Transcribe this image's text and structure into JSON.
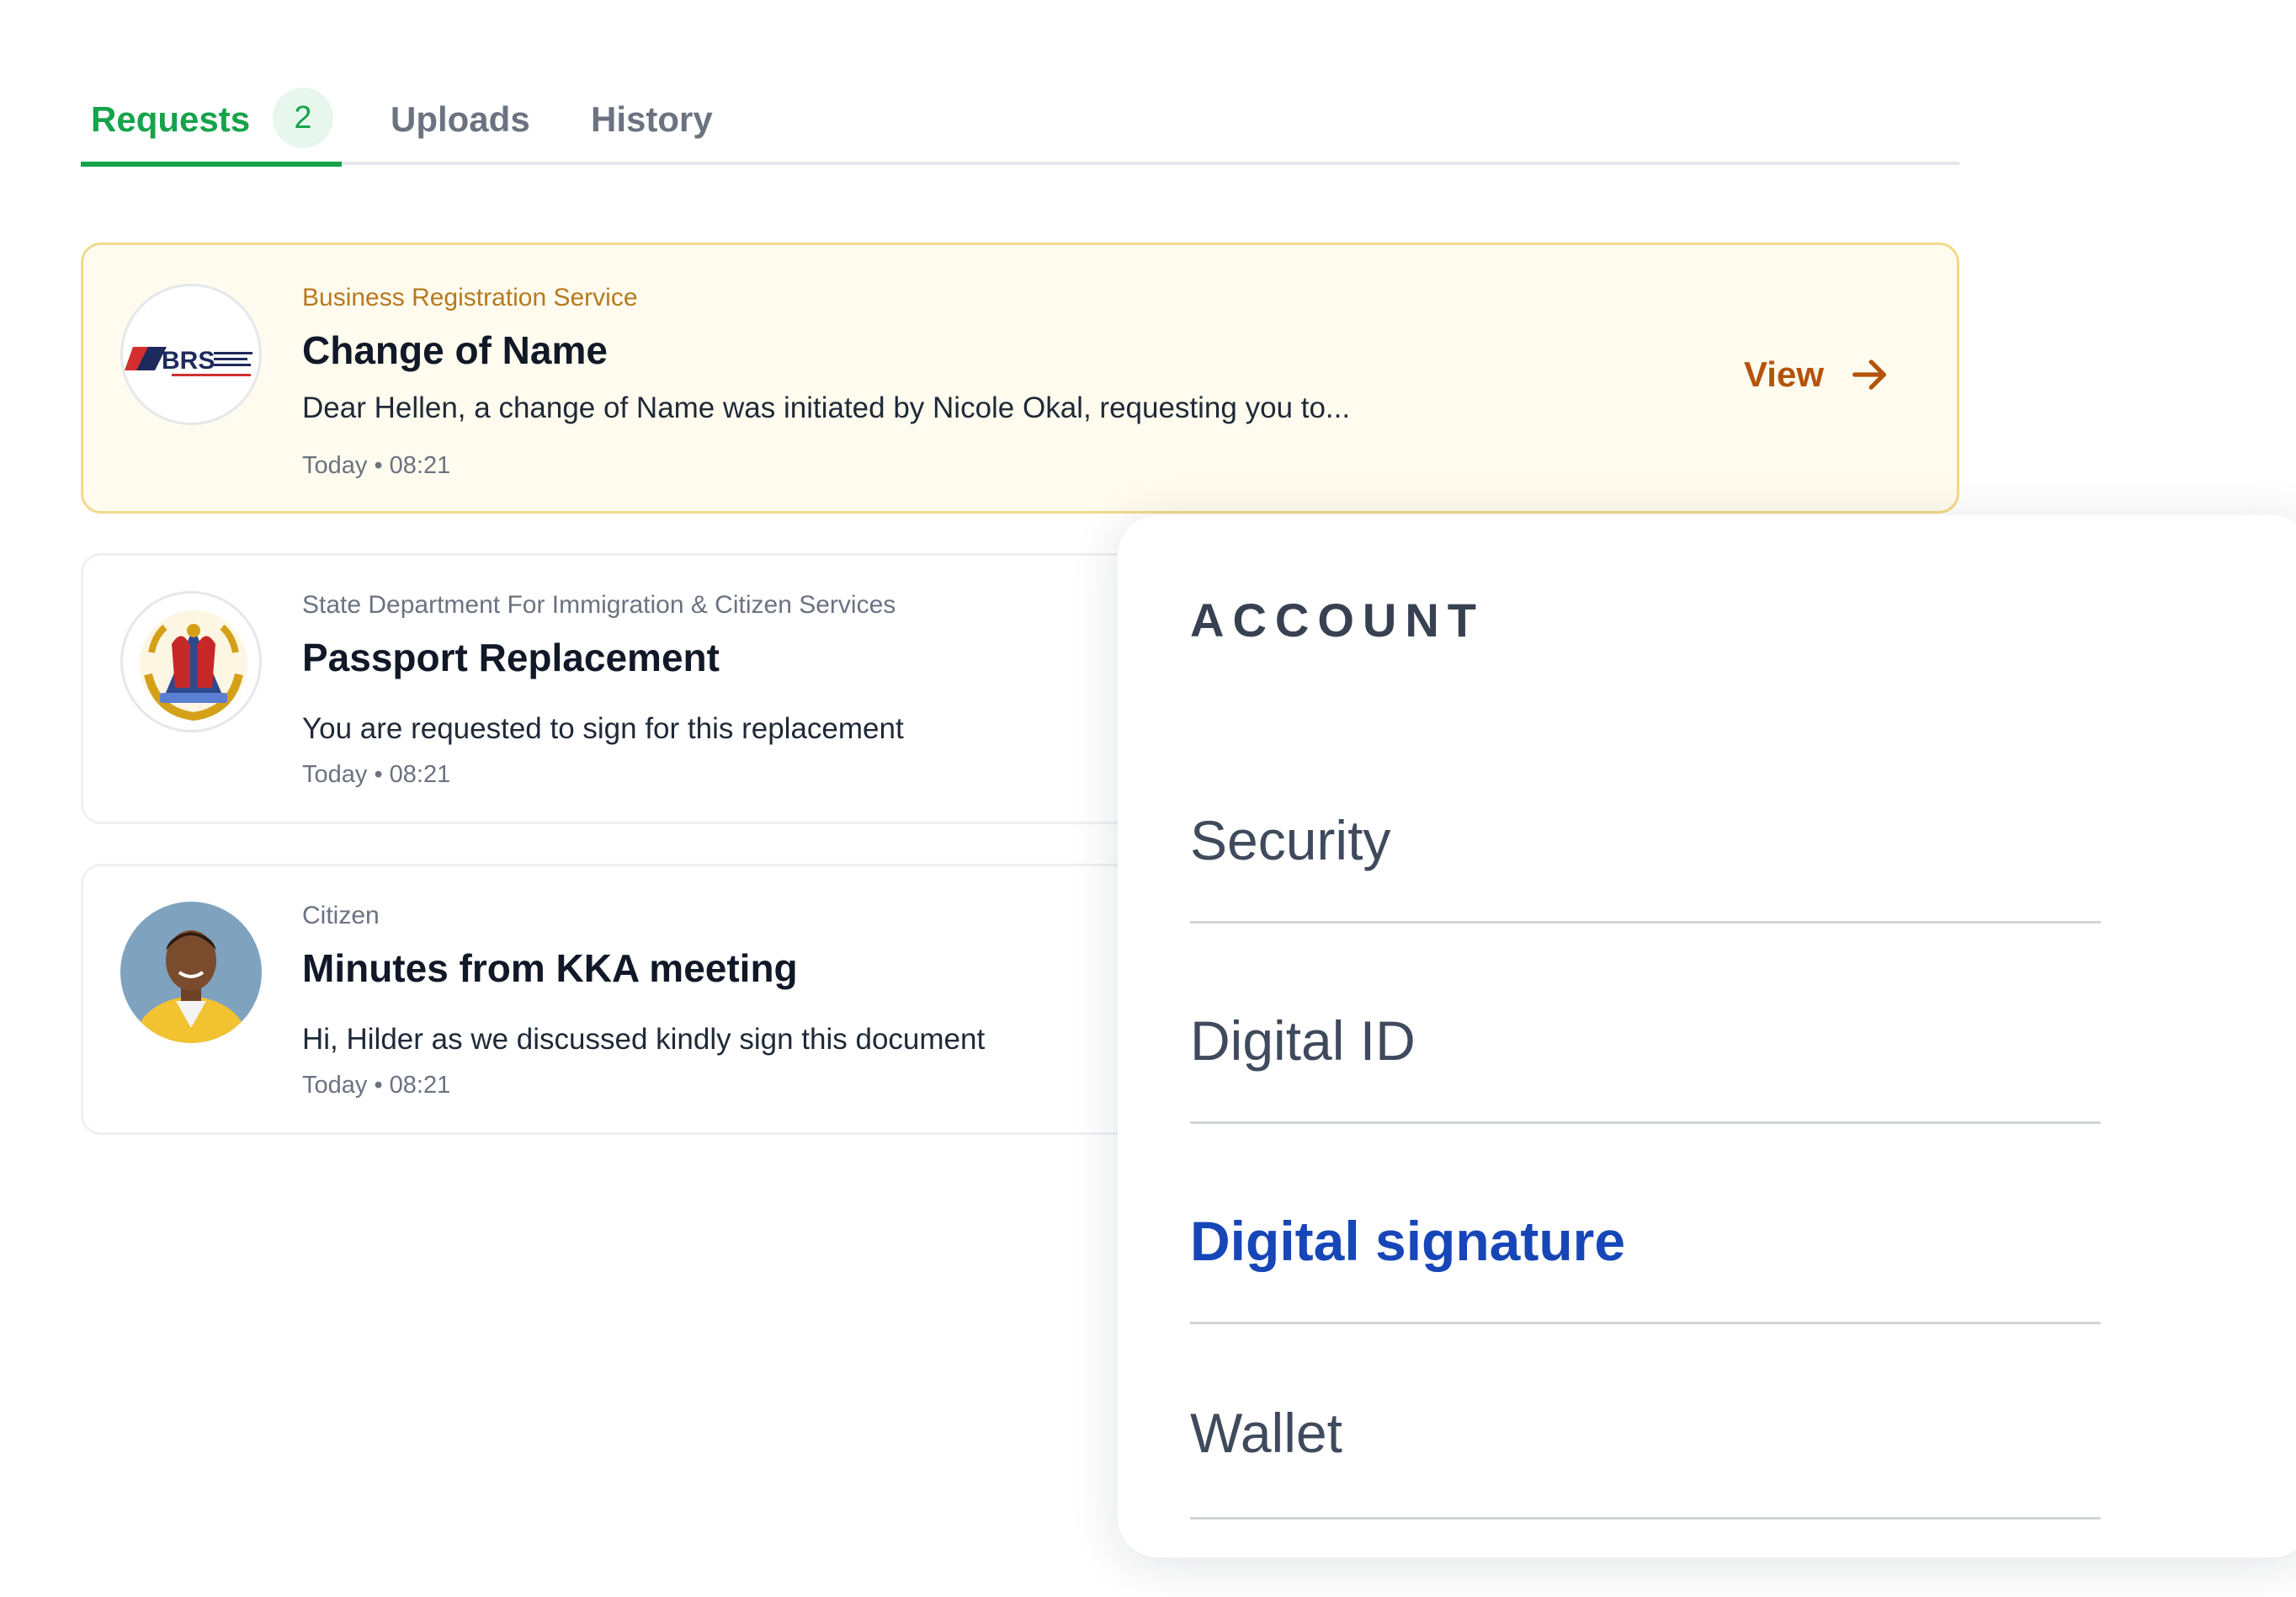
{
  "tabs": {
    "requests": {
      "label": "Requests",
      "badge": "2"
    },
    "uploads": {
      "label": "Uploads"
    },
    "history": {
      "label": "History"
    }
  },
  "requests": [
    {
      "sender": "Business Registration Service",
      "title": "Change of Name",
      "message": "Dear Hellen, a change of Name was initiated by Nicole Okal, requesting you to...",
      "time": "Today • 08:21",
      "action": "View",
      "logo_text": "BRS"
    },
    {
      "sender": "State Department For Immigration & Citizen Services",
      "title": "Passport Replacement",
      "message": "You are requested to sign for this replacement",
      "time": "Today • 08:21"
    },
    {
      "sender": "Citizen",
      "title": "Minutes from KKA meeting",
      "message": "Hi, Hilder as we discussed kindly sign this document",
      "time": "Today • 08:21"
    }
  ],
  "account": {
    "heading": "ACCOUNT",
    "items": [
      {
        "label": "Security"
      },
      {
        "label": "Digital ID"
      },
      {
        "label": "Digital signature",
        "active": true
      },
      {
        "label": "Wallet"
      }
    ]
  },
  "colors": {
    "accent_green": "#16a34a",
    "highlight_amber": "#b45309",
    "active_blue": "#1746b8"
  },
  "icons": [
    "brs-logo",
    "immigration-seal-logo",
    "user-photo-avatar",
    "arrow-right-icon"
  ]
}
